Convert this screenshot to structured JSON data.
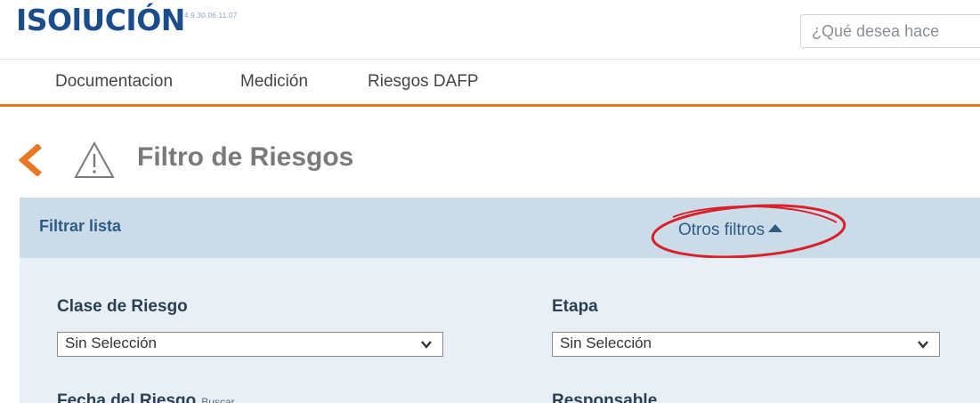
{
  "header": {
    "logo_text": "ISOlUCIÓN",
    "version": "4.9.30.06.11.07",
    "search_placeholder": "¿Qué desea hace"
  },
  "nav": {
    "items": [
      {
        "label": "Documentacion"
      },
      {
        "label": "Medición"
      },
      {
        "label": "Riesgos DAFP"
      }
    ]
  },
  "page": {
    "title": "Filtro de Riesgos",
    "icons": {
      "back": "chevron-left-icon",
      "title": "warning-triangle-icon"
    }
  },
  "filter": {
    "header_title": "Filtrar lista",
    "other_filters_label": "Otros filtros",
    "fields": [
      {
        "label": "Clase de Riesgo",
        "value": "Sin Selección"
      },
      {
        "label": "Etapa",
        "value": "Sin Selección"
      },
      {
        "label": "Fecha del Riesgo",
        "hint": "Buscar"
      },
      {
        "label": "Responsable"
      }
    ]
  },
  "colors": {
    "accent": "#e87722",
    "brand": "#1b4d8c",
    "filter_header_bg": "#cbdbe8",
    "filter_body_bg": "#e8eff5",
    "annotation_red": "#d8202a"
  }
}
